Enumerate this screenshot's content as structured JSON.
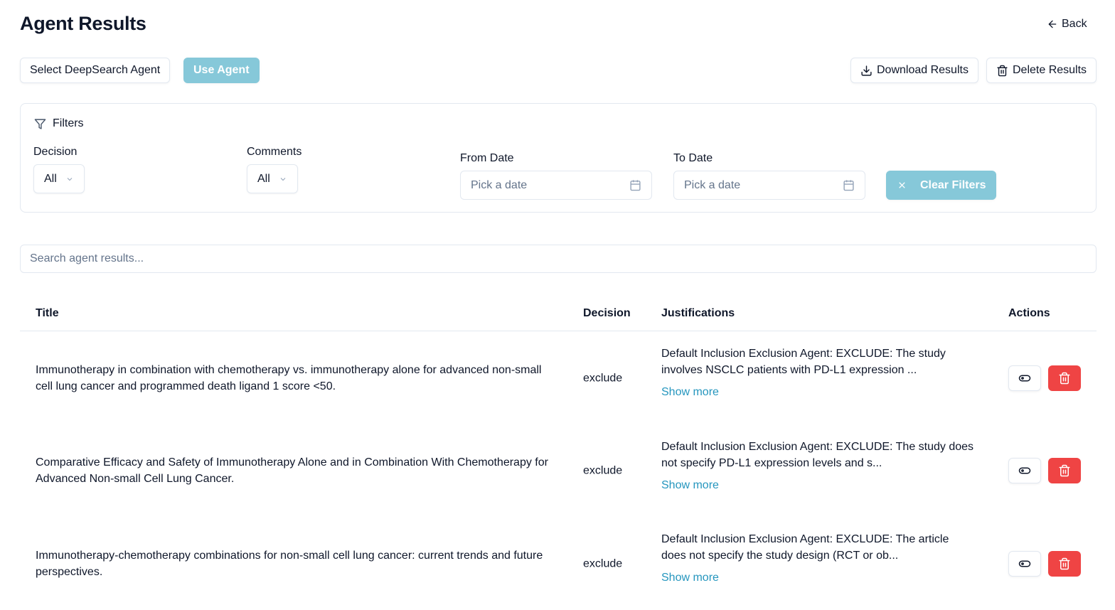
{
  "header": {
    "title": "Agent Results",
    "back_label": "Back"
  },
  "toolbar": {
    "select_agent_label": "Select DeepSearch Agent",
    "use_agent_label": "Use Agent",
    "download_label": "Download Results",
    "delete_label": "Delete Results"
  },
  "filters": {
    "title": "Filters",
    "decision_label": "Decision",
    "decision_value": "All",
    "comments_label": "Comments",
    "comments_value": "All",
    "from_label": "From Date",
    "from_placeholder": "Pick a date",
    "to_label": "To Date",
    "to_placeholder": "Pick a date",
    "clear_label": "Clear Filters"
  },
  "search": {
    "placeholder": "Search agent results..."
  },
  "table": {
    "headers": {
      "title": "Title",
      "decision": "Decision",
      "justifications": "Justifications",
      "actions": "Actions"
    },
    "show_more": "Show more",
    "rows": [
      {
        "title": "Immunotherapy in combination with chemotherapy vs. immunotherapy alone for advanced non-small cell lung cancer and programmed death ligand 1 score <50.",
        "decision": "exclude",
        "justification": "Default Inclusion Exclusion Agent: EXCLUDE: The study involves NSCLC patients with PD-L1 expression ..."
      },
      {
        "title": "Comparative Efficacy and Safety of Immunotherapy Alone and in Combination With Chemotherapy for Advanced Non-small Cell Lung Cancer.",
        "decision": "exclude",
        "justification": "Default Inclusion Exclusion Agent: EXCLUDE: The study does not specify PD-L1 expression levels and s..."
      },
      {
        "title": "Immunotherapy-chemotherapy combinations for non-small cell lung cancer: current trends and future perspectives.",
        "decision": "exclude",
        "justification": "Default Inclusion Exclusion Agent: EXCLUDE: The article does not specify the study design (RCT or ob..."
      }
    ]
  }
}
